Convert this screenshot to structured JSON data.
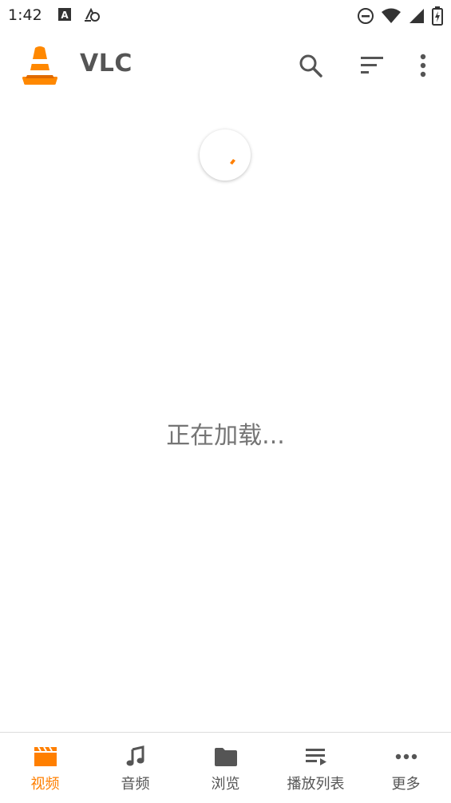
{
  "status_bar": {
    "time": "1:42",
    "left_icons": [
      "font-notification-icon",
      "sync-notification-icon"
    ],
    "right_icons": [
      "do-not-disturb-icon",
      "wifi-icon",
      "cell-signal-icon",
      "battery-icon"
    ]
  },
  "app_bar": {
    "title": "VLC",
    "actions": [
      "search-icon",
      "sort-icon",
      "overflow-menu-icon"
    ]
  },
  "main": {
    "loading_text": "正在加载..."
  },
  "bottom_nav": {
    "items": [
      {
        "label": "视频",
        "icon": "video-icon",
        "active": true
      },
      {
        "label": "音频",
        "icon": "music-note-icon",
        "active": false
      },
      {
        "label": "浏览",
        "icon": "folder-icon",
        "active": false
      },
      {
        "label": "播放列表",
        "icon": "playlist-icon",
        "active": false
      },
      {
        "label": "更多",
        "icon": "more-icon",
        "active": false
      }
    ]
  },
  "colors": {
    "accent": "#ff7f00",
    "title_text": "#555555",
    "loading_text": "#757575",
    "icon_gray": "#555555"
  }
}
